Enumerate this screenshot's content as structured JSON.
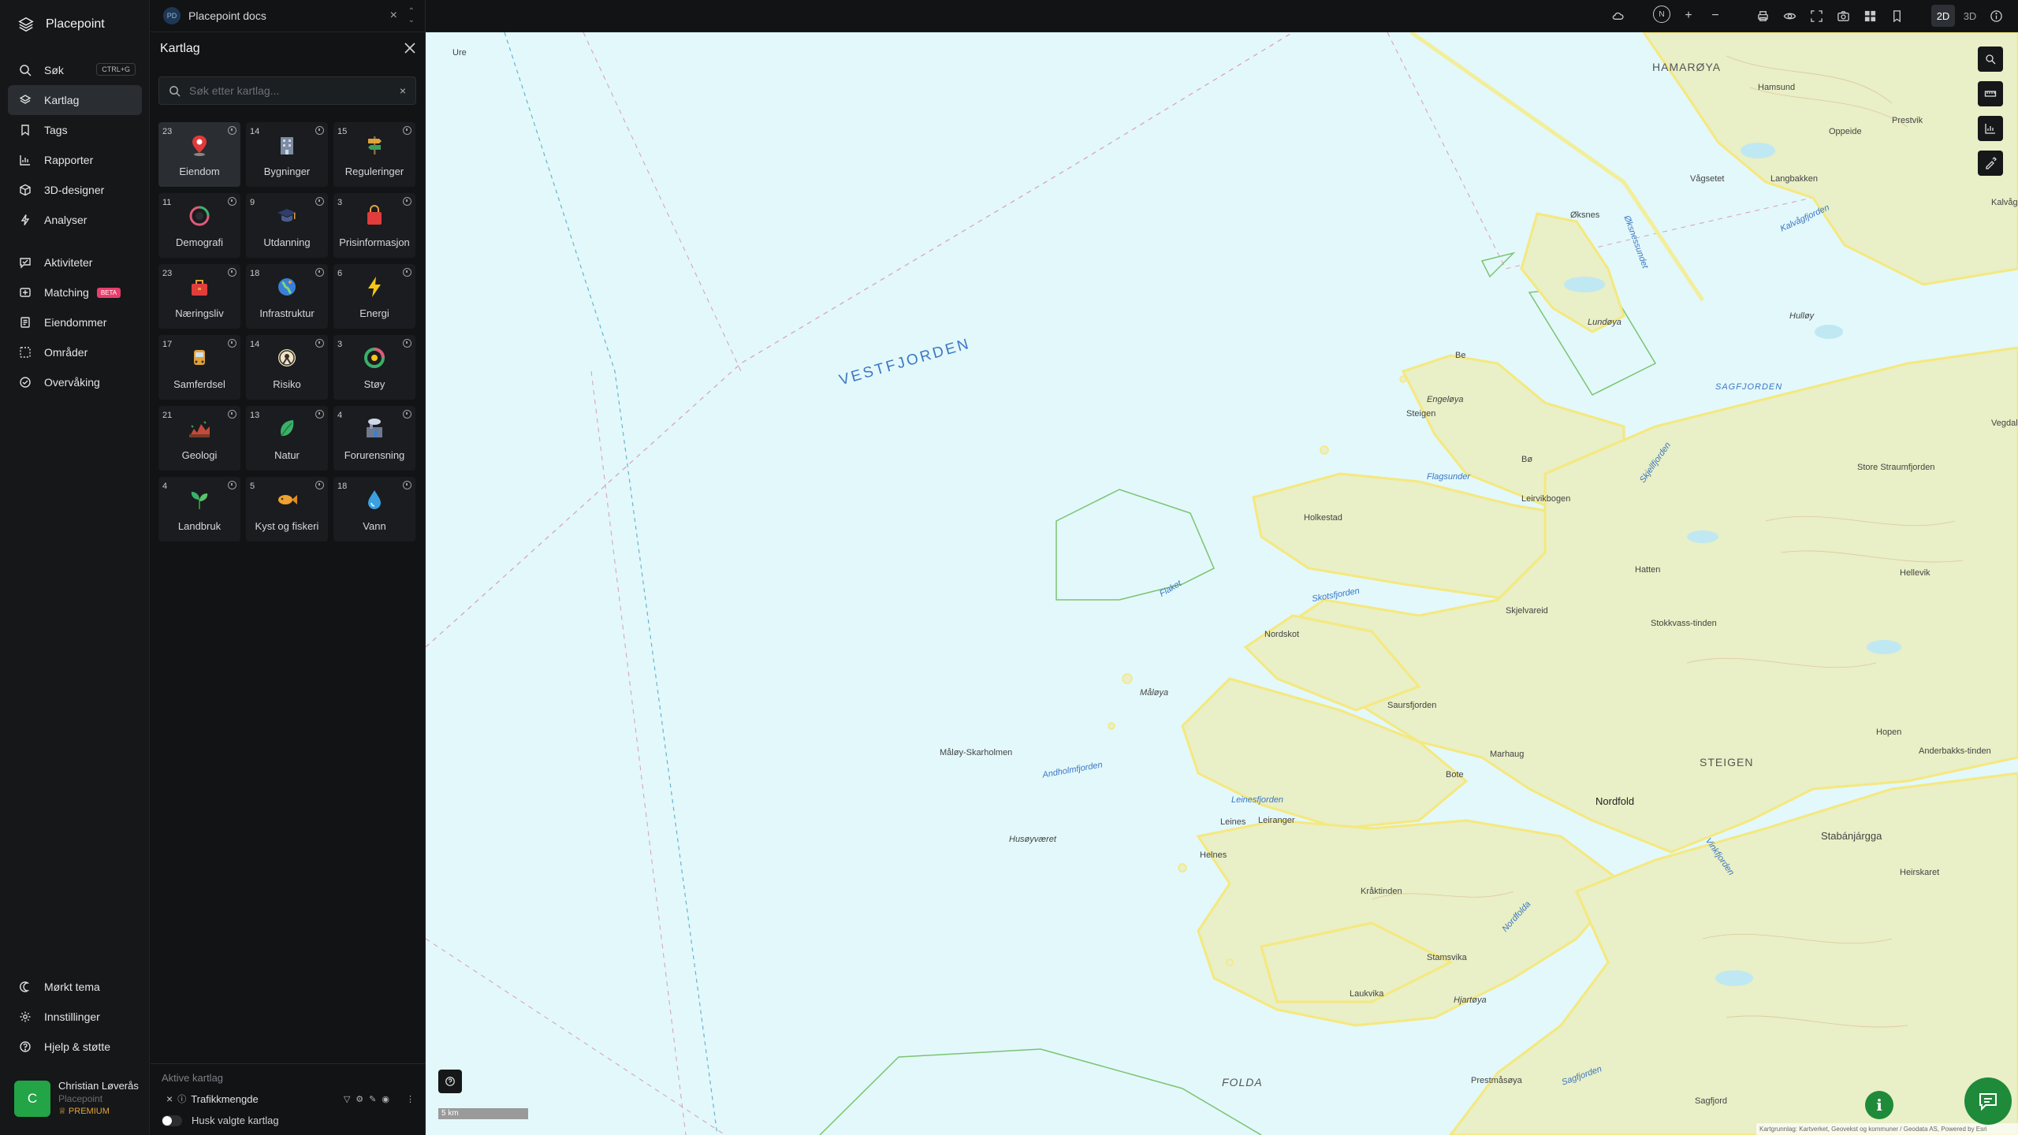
{
  "app": {
    "name": "Placepoint"
  },
  "nav": {
    "items": [
      {
        "label": "Søk",
        "shortcut": "CTRL+G"
      },
      {
        "label": "Kartlag"
      },
      {
        "label": "Tags"
      },
      {
        "label": "Rapporter"
      },
      {
        "label": "3D-designer"
      },
      {
        "label": "Analyser"
      },
      {
        "label": "Aktiviteter"
      },
      {
        "label": "Matching",
        "badge": "BETA"
      },
      {
        "label": "Eiendommer"
      },
      {
        "label": "Områder"
      },
      {
        "label": "Overvåking"
      }
    ],
    "bottom": [
      {
        "label": "Mørkt tema"
      },
      {
        "label": "Innstillinger"
      },
      {
        "label": "Hjelp & støtte"
      }
    ]
  },
  "user": {
    "initial": "C",
    "name": "Christian Løverås",
    "org": "Placepoint",
    "plan": "PREMIUM"
  },
  "docs_tab": {
    "badge": "PD",
    "title": "Placepoint docs"
  },
  "panel": {
    "title": "Kartlag",
    "search_placeholder": "Søk etter kartlag...",
    "tiles": [
      {
        "count": "23",
        "label": "Eiendom",
        "icon": "pin-icon"
      },
      {
        "count": "14",
        "label": "Bygninger",
        "icon": "building-icon"
      },
      {
        "count": "15",
        "label": "Reguleringer",
        "icon": "signpost-icon"
      },
      {
        "count": "11",
        "label": "Demografi",
        "icon": "demography-icon"
      },
      {
        "count": "9",
        "label": "Utdanning",
        "icon": "graduation-icon"
      },
      {
        "count": "3",
        "label": "Prisinformasjon",
        "icon": "shopping-bag-icon"
      },
      {
        "count": "23",
        "label": "Næringsliv",
        "icon": "business-bag-icon"
      },
      {
        "count": "18",
        "label": "Infrastruktur",
        "icon": "globe-icon"
      },
      {
        "count": "6",
        "label": "Energi",
        "icon": "lightning-icon"
      },
      {
        "count": "17",
        "label": "Samferdsel",
        "icon": "bus-icon"
      },
      {
        "count": "14",
        "label": "Risiko",
        "icon": "hazard-icon"
      },
      {
        "count": "3",
        "label": "Støy",
        "icon": "noise-gauge-icon"
      },
      {
        "count": "21",
        "label": "Geologi",
        "icon": "terrain-icon"
      },
      {
        "count": "13",
        "label": "Natur",
        "icon": "leaf-icon"
      },
      {
        "count": "4",
        "label": "Forurensning",
        "icon": "factory-icon"
      },
      {
        "count": "4",
        "label": "Landbruk",
        "icon": "sprout-icon"
      },
      {
        "count": "5",
        "label": "Kyst og fiskeri",
        "icon": "fish-icon"
      },
      {
        "count": "18",
        "label": "Vann",
        "icon": "water-drop-icon"
      }
    ],
    "active_title": "Aktive kartlag",
    "active_layers": [
      {
        "label": "Trafikkmengde"
      }
    ],
    "remember_label": "Husk valgte kartlag"
  },
  "toolbar": {
    "compass": "N",
    "mode_2d": "2D",
    "mode_3d": "3D"
  },
  "map": {
    "scale_label": "5 km",
    "attribution": "Kartgrunnlag: Kartverket, Geovekst og kommuner / Geodata AS, Powered by Esri",
    "labels": {
      "vestfjorden": "VESTFJORDEN",
      "hamaroy": "HAMARØYA",
      "steigen": "STEIGEN",
      "folda": "FOLDA",
      "nordfold": "Nordfold",
      "sagfjorden": "SAGFJORDEN",
      "kalvagfjorden": "Kalvågfjorden",
      "oksnes": "Øksnes",
      "lundoya": "Lundøya",
      "engeloya": "Engeløya",
      "steigen_village": "Steigen",
      "be": "Be",
      "bo": "Bø",
      "flagsunder": "Flagsunder",
      "holkestad": "Holkestad",
      "leinesfjorden": "Leinesfjorden",
      "leines": "Leines",
      "leiranger": "Leiranger",
      "helnes": "Helnes",
      "moloy": "Måløya",
      "moloy_skarholmen": "Måløy-Skarholmen",
      "andholmfjorden": "Andholmfjorden",
      "husoyvaeret": "Husøyværet",
      "nordskot": "Nordskot",
      "skotsfjorden": "Skotsfjorden",
      "flaket": "Flaket",
      "sjovaag": "Skjelvareid",
      "saursfjorden": "Saursfjorden",
      "marhaug": "Marhaug",
      "bote": "Bote",
      "stamsvika": "Stamsvika",
      "laukvika": "Laukvika",
      "hjartoya": "Hjartøya",
      "nordfolda": "Nordfolda",
      "vinkfjorden": "Vinkfjorden",
      "sagfjorden2": "Sagfjorden",
      "prestmaoya": "Prestmåsøya",
      "kraktinden": "Kråktinden",
      "stabanjarga": "Stabánjárgga",
      "store_straumfjorden": "Store Straumfjorden",
      "anderbakkstinden": "Anderbakks-tinden",
      "hopen": "Hopen",
      "hatten": "Hatten",
      "stokkvastinden": "Stokkvass-tinden",
      "ure": "Ure",
      "oksnesundet": "Øksnessundet",
      "langbakken": "Langbakken",
      "vagsetet": "Vågsetet",
      "huday": "Hulløy",
      "prestvik": "Prestvik",
      "hamsund": "Hamsund",
      "oppeide": "Oppeide",
      "kalvag": "Kalvåg",
      "leirvikbogen": "Leirvikbogen",
      "skjelfjorden": "Skjellfjorden",
      "sorfold": "Sagfjord",
      "hellevik": "Hellevik",
      "heirskaret": "Heirskaret",
      "vegdal": "Vegdal"
    }
  }
}
